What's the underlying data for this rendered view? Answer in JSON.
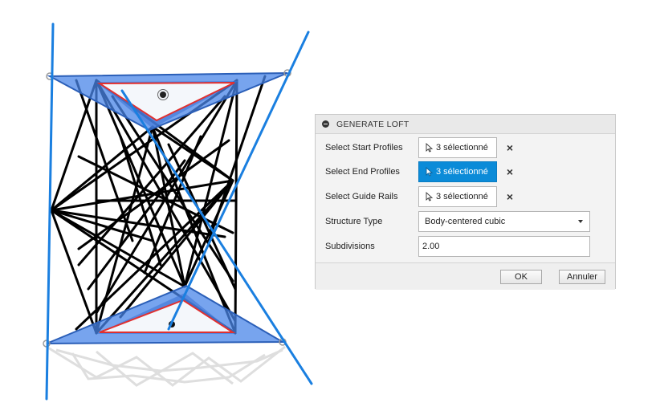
{
  "panel": {
    "title": "GENERATE LOFT",
    "rows": {
      "start_profiles": {
        "label": "Select Start Profiles",
        "value": "3 sélectionné"
      },
      "end_profiles": {
        "label": "Select End Profiles",
        "value": "3 sélectionné"
      },
      "guide_rails": {
        "label": "Select Guide Rails",
        "value": "3 sélectionné"
      },
      "structure_type": {
        "label": "Structure Type",
        "value": "Body-centered cubic"
      },
      "subdivisions": {
        "label": "Subdivisions",
        "value": "2.00"
      }
    },
    "ok_label": "OK",
    "cancel_label": "Annuler"
  },
  "icons": {
    "collapse": "collapse-icon",
    "cursor": "pointer-cursor-icon",
    "clear": "close-icon",
    "dropdown": "chevron-down-icon"
  },
  "colors": {
    "active_selection": "#0b8bd8",
    "guide_rail": "#1a7fe0",
    "profile_fill": "#4a86e8",
    "profile_outline": "#e03030",
    "lattice_strut": "#000000"
  }
}
